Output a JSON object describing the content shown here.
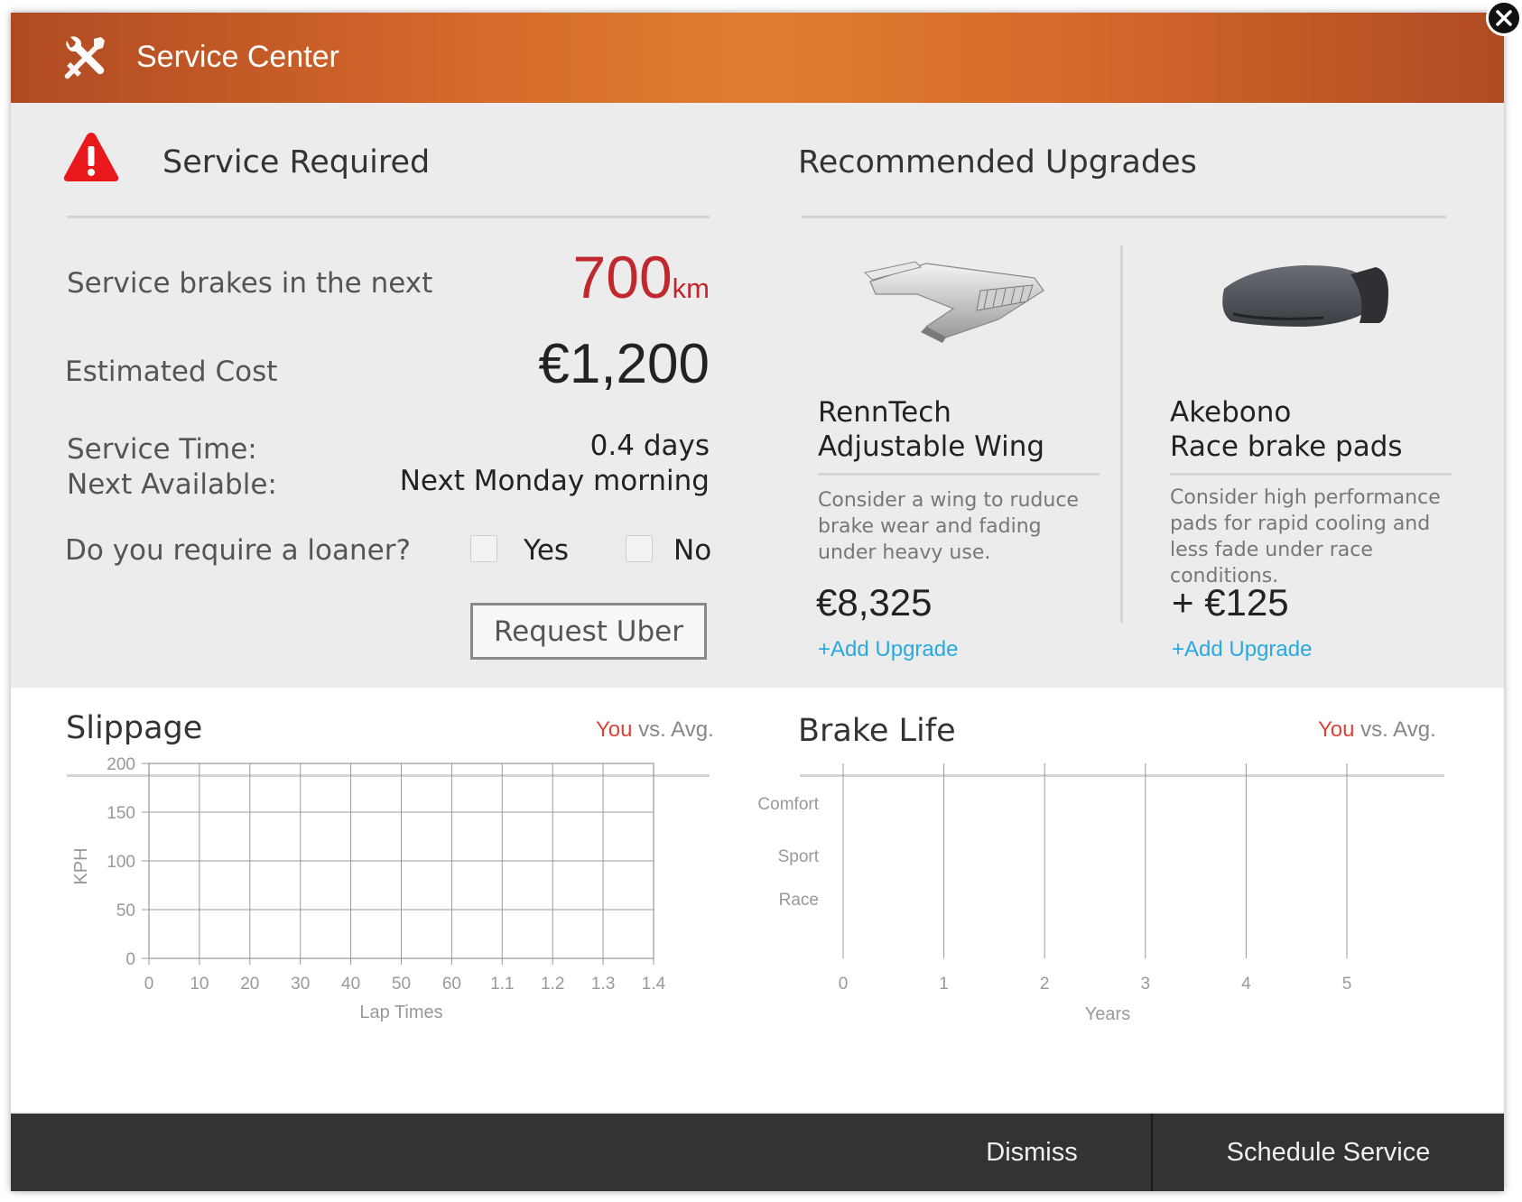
{
  "header": {
    "title": "Service Center",
    "icon": "wrench-screwdriver-icon"
  },
  "service": {
    "heading": "Service Required",
    "brakes_label": "Service brakes in the next",
    "brakes_value": "700",
    "brakes_unit": "km",
    "cost_label": "Estimated Cost",
    "cost_value": "€1,200",
    "time_label": "Service Time:",
    "time_value": "0.4 days",
    "next_label": "Next Available:",
    "next_value": "Next Monday morning",
    "loaner_label": "Do you require a loaner?",
    "loaner_yes": "Yes",
    "loaner_no": "No",
    "request_button": "Request Uber",
    "alert_color": "#e02020"
  },
  "upgrades": {
    "heading": "Recommended Upgrades",
    "items": [
      {
        "title_line1": "RennTech",
        "title_line2": "Adjustable Wing",
        "description": "Consider a wing to ruduce brake wear and fading under heavy use.",
        "price": "€8,325",
        "action": "+Add Upgrade",
        "image": "rear-wing-image"
      },
      {
        "title_line1": "Akebono",
        "title_line2": "Race brake pads",
        "description": "Consider high performance pads for rapid cooling and less fade under race conditions.",
        "price": "+ €125",
        "action": "+Add Upgrade",
        "image": "brake-pad-image"
      }
    ]
  },
  "slippage": {
    "heading": "Slippage",
    "legend_you": "You",
    "legend_rest": " vs. Avg."
  },
  "brake_life": {
    "heading": "Brake Life",
    "legend_you": "You",
    "legend_rest": " vs. Avg."
  },
  "chart_data": [
    {
      "type": "line",
      "title": "Slippage",
      "xlabel": "Lap Times",
      "ylabel": "KPH",
      "x_ticks": [
        "0",
        "10",
        "20",
        "30",
        "40",
        "50",
        "60",
        "1.1",
        "1.2",
        "1.3",
        "1.4"
      ],
      "y_ticks": [
        "0",
        "50",
        "100",
        "150",
        "200"
      ],
      "ylim": [
        0,
        200
      ],
      "grid": true,
      "series": []
    },
    {
      "type": "bar",
      "title": "Brake Life",
      "xlabel": "Years",
      "ylabel": "",
      "x_ticks": [
        "0",
        "1",
        "2",
        "3",
        "4",
        "5"
      ],
      "categories": [
        "Comfort",
        "Sport",
        "Race"
      ],
      "xlim": [
        0,
        5
      ],
      "grid": true,
      "series": []
    }
  ],
  "footer": {
    "dismiss": "Dismiss",
    "schedule": "Schedule Service"
  },
  "colors": {
    "accent_red": "#c0282d",
    "link_blue": "#29a9e0",
    "header_orange": "#e07d30",
    "footer_dark": "#333333"
  }
}
